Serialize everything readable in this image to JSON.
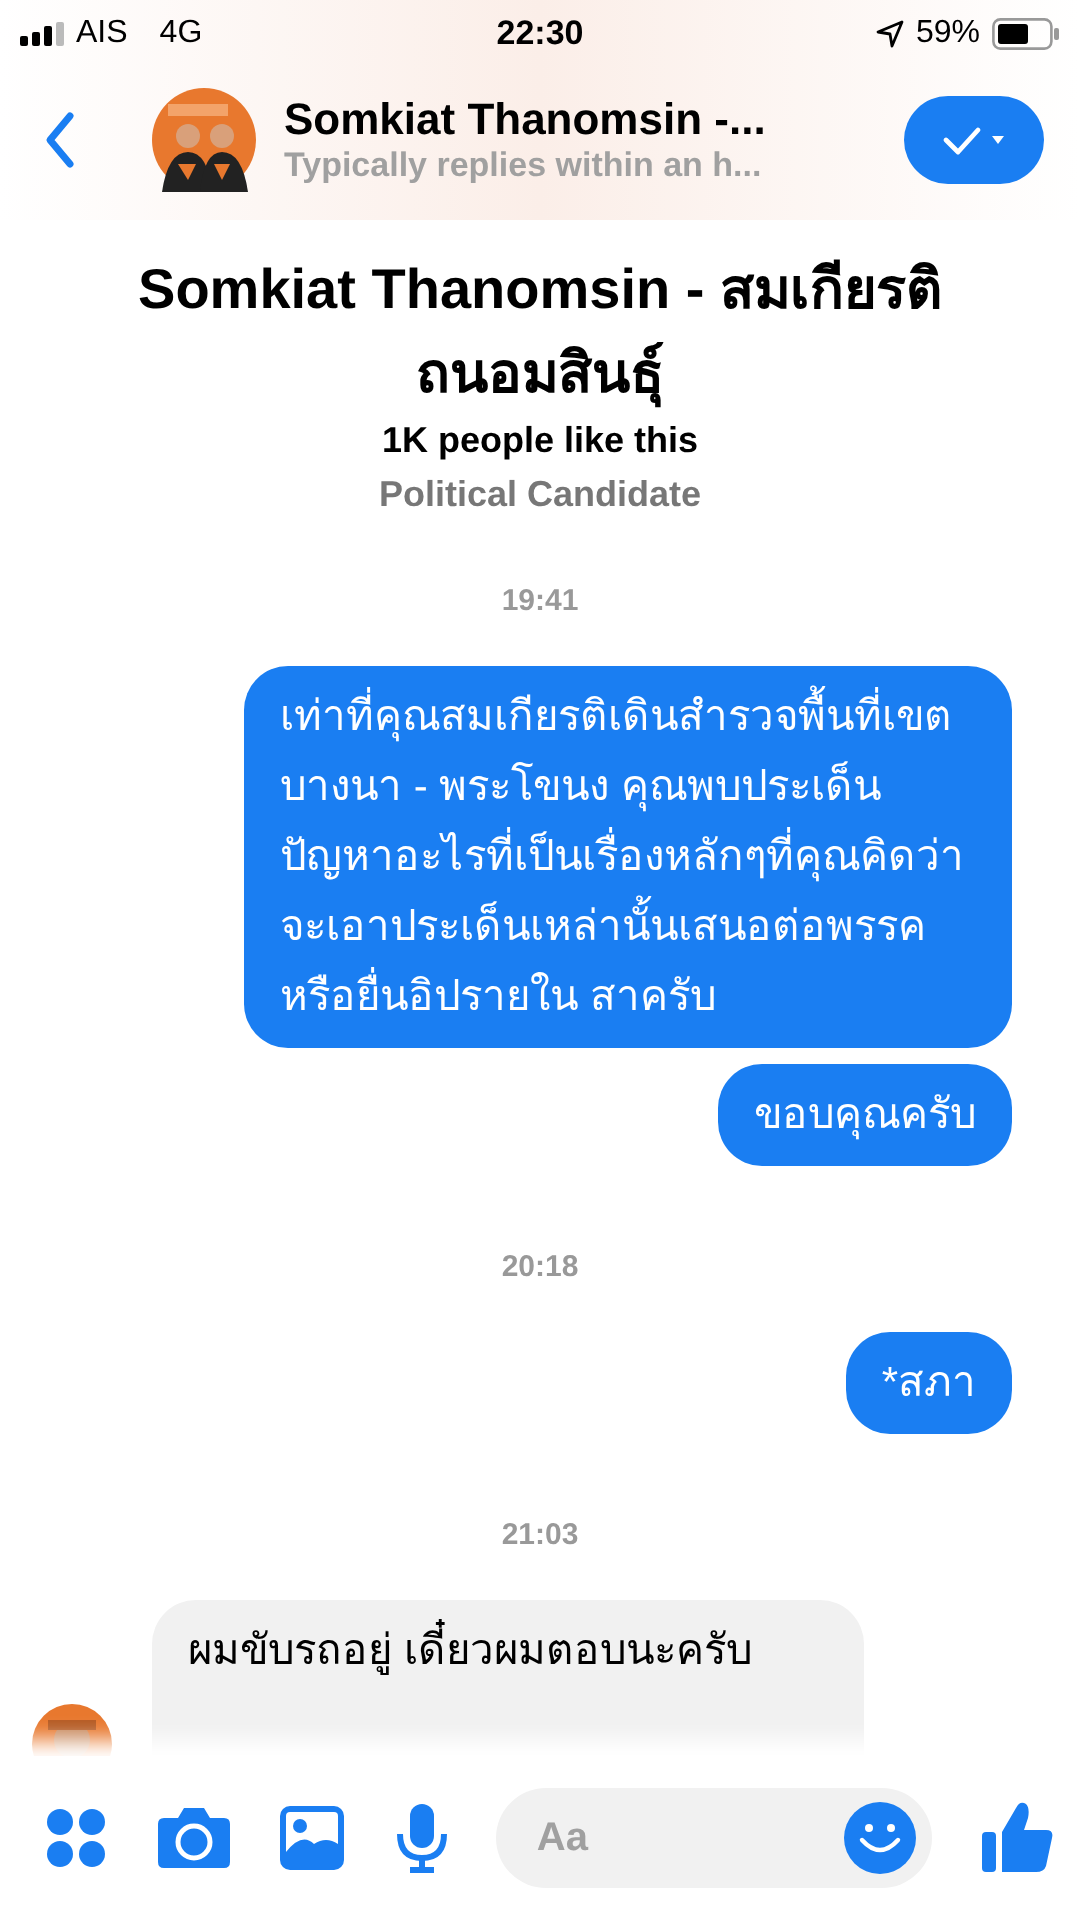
{
  "status_bar": {
    "carrier": "AIS",
    "network": "4G",
    "time": "22:30",
    "battery": "59%"
  },
  "header": {
    "title": "Somkiat Thanomsin -...",
    "subtitle": "Typically replies within an h..."
  },
  "profile": {
    "name": "Somkiat Thanomsin - สมเกียรติ ถนอมสินธุ์",
    "likes": "1K people like this",
    "category": "Political Candidate"
  },
  "messages": [
    {
      "kind": "time",
      "text": "19:41"
    },
    {
      "kind": "sent",
      "text": "เท่าที่คุณสมเกียรติเดินสำรวจพื้นที่เขตบางนา - พระโขนง คุณพบประเด็นปัญหาอะไรที่เป็นเรื่องหลักๆที่คุณคิดว่าจะเอาประเด็นเหล่านั้นเสนอต่อพรรคหรือยื่นอิปรายใน สาครับ"
    },
    {
      "kind": "sent",
      "text": "ขอบคุณครับ"
    },
    {
      "kind": "time",
      "text": "20:18"
    },
    {
      "kind": "sent",
      "text": "*สภา"
    },
    {
      "kind": "time",
      "text": "21:03"
    },
    {
      "kind": "received",
      "text": "ผมขับรถอยู่ เดี๋ยวผมตอบนะครับ"
    }
  ],
  "composer": {
    "placeholder": "Aa"
  }
}
